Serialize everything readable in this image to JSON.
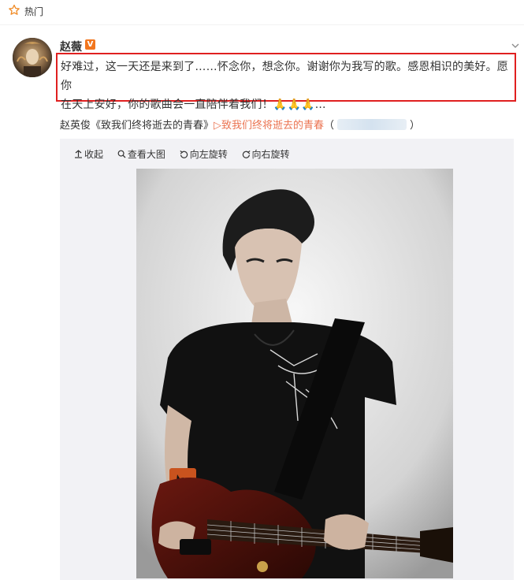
{
  "header": {
    "section_label": "热门"
  },
  "post": {
    "username": "赵薇",
    "vip_badge": "V",
    "text_line1": "好难过，这一天还是来到了……怀念你，想念你。谢谢你为我写的歌。感恩相识的美好。愿你",
    "text_line2_prefix": "在天上安好，你的歌曲会一直陪伴着我们！",
    "text_emoji": "🙏🙏🙏",
    "text_ellipsis": "...",
    "song_prefix": "赵英俊《致我们终将逝去的青春》",
    "song_link": "▷致我们终将逝去的青春",
    "song_paren_open": "（",
    "song_paren_close": "）"
  },
  "toolbar": {
    "collapse": "收起",
    "view_large": "查看大图",
    "rotate_left": "向左旋转",
    "rotate_right": "向右旋转"
  },
  "colors": {
    "accent": "#eb7350",
    "highlight_border": "#e02020",
    "vip": "#f2761e"
  },
  "icons": [
    "hot-star-icon",
    "vip-badge-icon",
    "more-chevron-icon",
    "collapse-icon",
    "view-large-icon",
    "rotate-left-icon",
    "rotate-right-icon"
  ]
}
